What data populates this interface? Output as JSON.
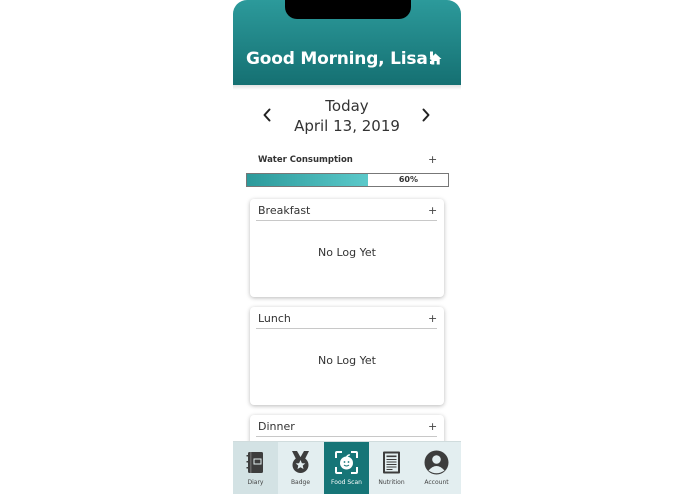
{
  "header": {
    "greeting": "Good Morning, Lisa!",
    "home_icon": "home-icon"
  },
  "date_nav": {
    "day_label": "Today",
    "date": "April 13, 2019"
  },
  "water": {
    "label": "Water Consumption",
    "add_symbol": "+",
    "progress_percent": 60,
    "progress_text": "60%"
  },
  "meals": [
    {
      "title": "Breakfast",
      "add_symbol": "+",
      "empty_text": "No Log Yet"
    },
    {
      "title": "Lunch",
      "add_symbol": "+",
      "empty_text": "No Log Yet"
    },
    {
      "title": "Dinner",
      "add_symbol": "+"
    }
  ],
  "tabs": [
    {
      "label": "Diary",
      "icon": "diary-icon"
    },
    {
      "label": "Badge",
      "icon": "badge-icon"
    },
    {
      "label": "Food Scan",
      "icon": "food-scan-icon"
    },
    {
      "label": "Nutrition",
      "icon": "nutrition-icon"
    },
    {
      "label": "Account",
      "icon": "account-icon"
    }
  ],
  "colors": {
    "brand_teal": "#167577",
    "teal_light": "#2c9a9b",
    "tabbar_bg": "#e3eef0"
  }
}
